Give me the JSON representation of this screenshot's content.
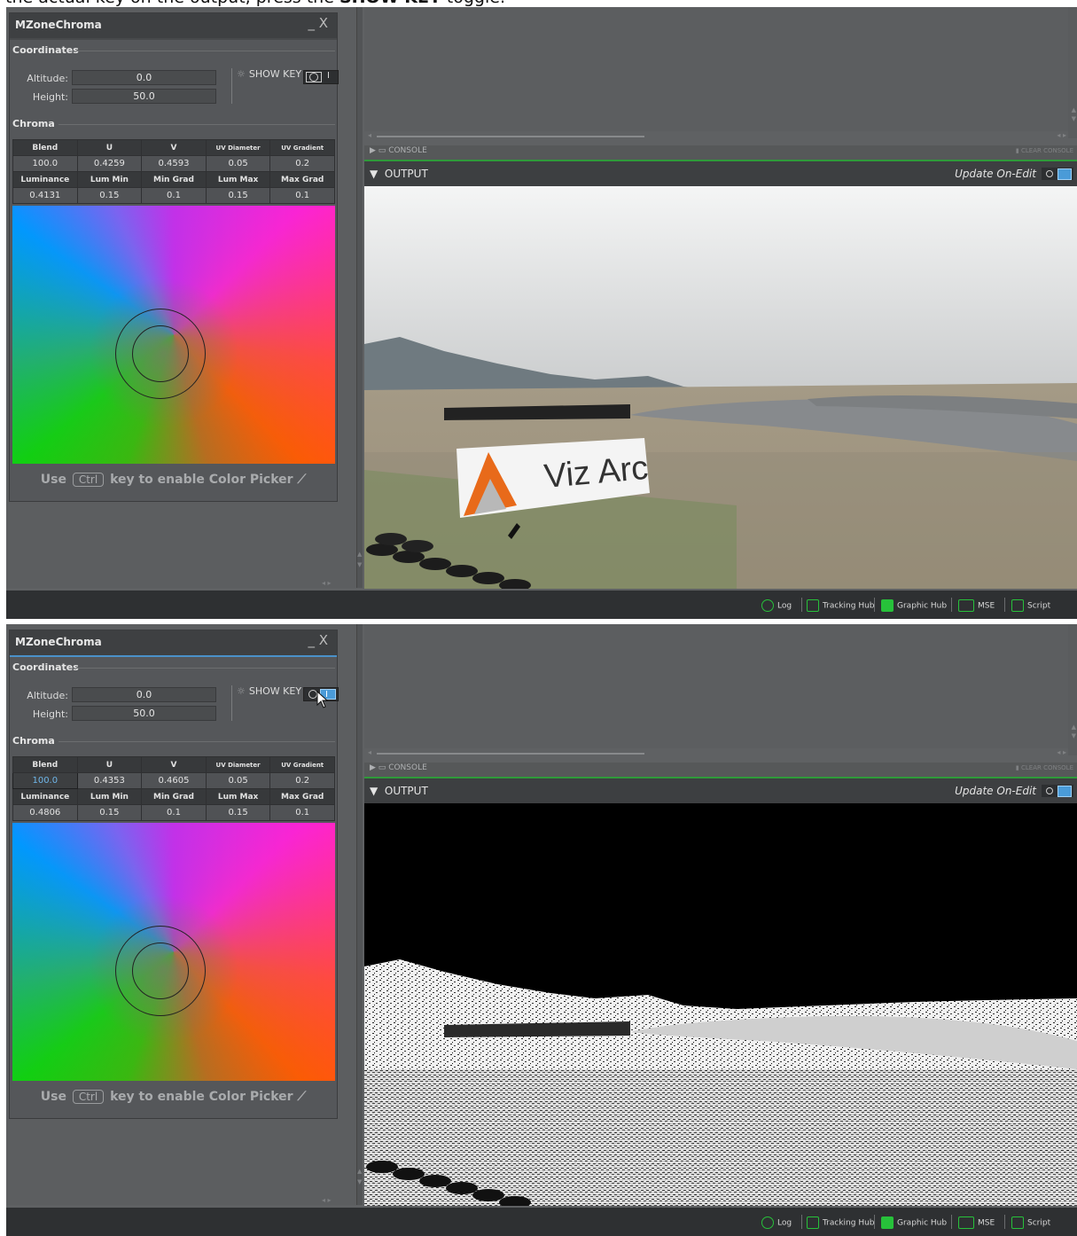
{
  "caption": {
    "before": "the actual key on the output, press the ",
    "bold": "SHOW KEY",
    "after": " toggle."
  },
  "screens": [
    {
      "panel": {
        "title": "MZoneChroma",
        "window_controls": "_ X",
        "coordinates_label": "Coordinates",
        "altitude_label": "Altitude:",
        "altitude_value": "0.0",
        "height_label": "Height:",
        "height_value": "50.0",
        "show_key_label": "SHOW KEY",
        "show_key_on": false,
        "chroma_label": "Chroma",
        "table": {
          "headers1": [
            "Blend",
            "U",
            "V",
            "UV Diameter",
            "UV Gradient"
          ],
          "values1": [
            "100.0",
            "0.4259",
            "0.4593",
            "0.05",
            "0.2"
          ],
          "headers2": [
            "Luminance",
            "Lum Min",
            "Min Grad",
            "Lum Max",
            "Max Grad"
          ],
          "values2": [
            "0.4131",
            "0.15",
            "0.1",
            "0.15",
            "0.1"
          ]
        },
        "use_text": "Use",
        "ctrl_key": "Ctrl",
        "picker_text": "key to enable Color Picker"
      },
      "console_label": "CONSOLE",
      "clear_console_label": "CLEAR CONSOLE",
      "output_label": "OUTPUT",
      "update_label": "Update On-Edit",
      "viewport_mode": "color",
      "logo_text": "Viz Arc"
    },
    {
      "panel": {
        "title": "MZoneChroma",
        "window_controls": "_ X",
        "coordinates_label": "Coordinates",
        "altitude_label": "Altitude:",
        "altitude_value": "0.0",
        "height_label": "Height:",
        "height_value": "50.0",
        "show_key_label": "SHOW KEY",
        "show_key_on": true,
        "chroma_label": "Chroma",
        "table": {
          "headers1": [
            "Blend",
            "U",
            "V",
            "UV Diameter",
            "UV Gradient"
          ],
          "values1": [
            "100.0",
            "0.4353",
            "0.4605",
            "0.05",
            "0.2"
          ],
          "headers2": [
            "Luminance",
            "Lum Min",
            "Min Grad",
            "Lum Max",
            "Max Grad"
          ],
          "values2": [
            "0.4806",
            "0.15",
            "0.1",
            "0.15",
            "0.1"
          ]
        },
        "use_text": "Use",
        "ctrl_key": "Ctrl",
        "picker_text": "key to enable Color Picker"
      },
      "console_label": "CONSOLE",
      "clear_console_label": "CLEAR CONSOLE",
      "output_label": "OUTPUT",
      "update_label": "Update On-Edit",
      "viewport_mode": "key"
    }
  ],
  "statusbar": {
    "log": "Log",
    "tracking_hub": "Tracking Hub",
    "graphic_hub": "Graphic Hub",
    "mse": "MSE",
    "script": "Script"
  },
  "colors": {
    "accent_green": "#2f9a3a",
    "accent_blue": "#4a91c9"
  }
}
